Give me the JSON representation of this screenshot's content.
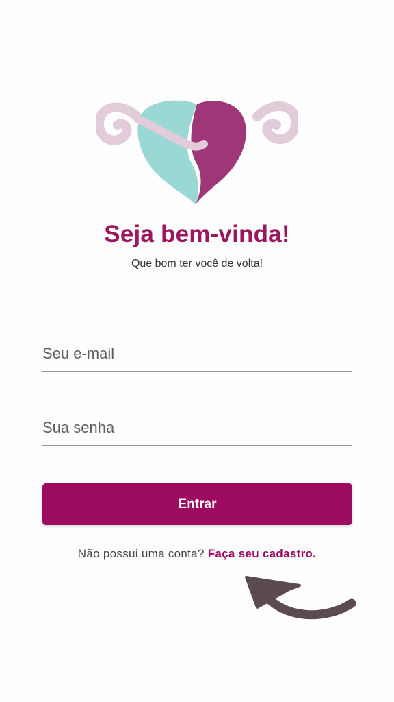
{
  "header": {
    "title": "Seja bem-vinda!",
    "subtitle": "Que bom ter você de volta!"
  },
  "form": {
    "email_placeholder": "Seu e-mail",
    "password_placeholder": "Sua senha",
    "submit_label": "Entrar"
  },
  "signup": {
    "prompt": "Não possui uma conta?",
    "link_label": "Faça seu cadastro."
  },
  "icons": {
    "logo": "uterus-heart-logo",
    "arrow": "curved-arrow-icon"
  },
  "colors": {
    "brand": "#9c0b60",
    "logo_teal": "#9ad8d3",
    "logo_pink": "#e2ccd9",
    "arrow": "#5c4a52"
  }
}
